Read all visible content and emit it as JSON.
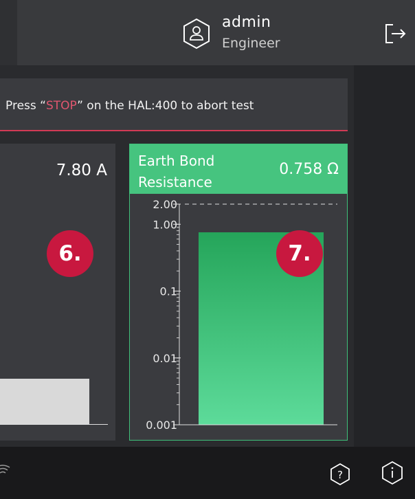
{
  "header": {
    "user_name": "admin",
    "user_role": "Engineer",
    "icons": {
      "user": "user-badge-icon",
      "logout": "logout-icon"
    }
  },
  "banner": {
    "text_before": "Press “",
    "stop_word": "STOP",
    "text_after": "” on the HAL:400 to abort test",
    "accent_color": "#d13a55"
  },
  "current_card": {
    "value": "7.80 A",
    "badge": "6.",
    "bar_color": "#d9d9d9"
  },
  "earth_card": {
    "title_line1": "Earth Bond",
    "title_line2": "Resistance",
    "value": "0.758 Ω",
    "badge": "7.",
    "accent_color": "#46c47f"
  },
  "chart_data": {
    "type": "bar",
    "scale": "log",
    "ylim": [
      0.001,
      2.0
    ],
    "limit_line": 2.0,
    "y_ticks": [
      {
        "value": 2.0,
        "label": "2.00"
      },
      {
        "value": 1.0,
        "label": "1.00"
      },
      {
        "value": 0.1,
        "label": "0.1"
      },
      {
        "value": 0.01,
        "label": "0.01"
      },
      {
        "value": 0.001,
        "label": "0.001"
      }
    ],
    "values": [
      0.758
    ],
    "bar_color_top": "#25a55a",
    "bar_color_bottom": "#5ddb9a"
  },
  "footer": {
    "icons": {
      "wifi": "wifi-icon",
      "help": "help-icon",
      "info": "info-icon"
    }
  }
}
